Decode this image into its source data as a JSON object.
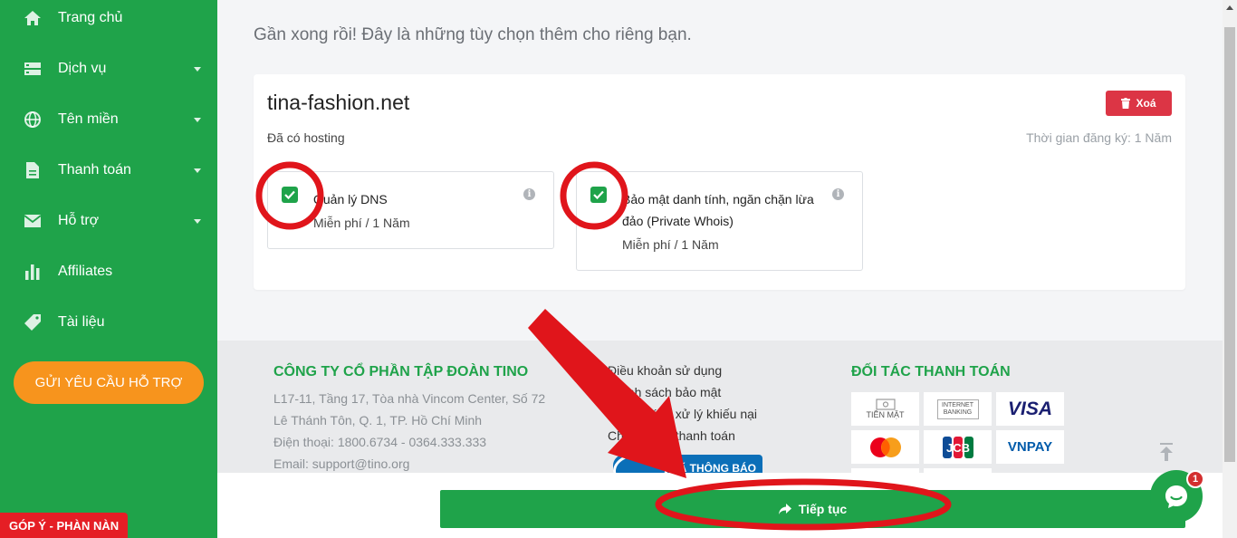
{
  "sidebar": {
    "items": [
      {
        "label": "Trang chủ",
        "icon": "home-icon",
        "has_submenu": false
      },
      {
        "label": "Dịch vụ",
        "icon": "server-icon",
        "has_submenu": true
      },
      {
        "label": "Tên miền",
        "icon": "globe-icon",
        "has_submenu": true
      },
      {
        "label": "Thanh toán",
        "icon": "document-icon",
        "has_submenu": true
      },
      {
        "label": "Hỗ trợ",
        "icon": "mail-icon",
        "has_submenu": true
      },
      {
        "label": "Affiliates",
        "icon": "bar-chart-icon",
        "has_submenu": false
      },
      {
        "label": "Tài liệu",
        "icon": "tag-icon",
        "has_submenu": false
      }
    ],
    "support_button": "GỬI YÊU CẦU HỖ TRỢ",
    "feedback_label": "GÓP Ý - PHÀN NÀN"
  },
  "main": {
    "headline": "Gần xong rồi! Đây là những tùy chọn thêm cho riêng bạn.",
    "domain": "tina-fashion.net",
    "hosting_status": "Đã có hosting",
    "registration_period": "Thời gian đăng ký: 1 Năm",
    "delete_label": "Xoá",
    "options": [
      {
        "title": "Quản lý DNS",
        "price": "Miễn phí / 1 Năm",
        "checked": true
      },
      {
        "title": "Bảo mật danh tính, ngăn chặn lừa đảo (Private Whois)",
        "price": "Miễn phí / 1 Năm",
        "checked": true
      }
    ]
  },
  "footer": {
    "company": "CÔNG TY CỔ PHẦN TẬP ĐOÀN TINO",
    "address_lines": [
      "L17-11, Tầng 17, Tòa nhà Vincom Center, Số 72",
      "Lê Thánh Tôn, Q. 1, TP. Hồ Chí Minh",
      "Điện thoại: 1800.6734 - 0364.333.333",
      "Email: support@tino.org"
    ],
    "links": [
      "Điều khoản sử dụng",
      "Chính sách bảo mật",
      "Chính sách xử lý khiếu nại",
      "Chính sách thanh toán"
    ],
    "certification": "ĐÃ THÔNG BÁO",
    "partners_title": "ĐỐI TÁC THANH TOÁN",
    "payment_methods": [
      "TIỀN MẶT",
      "INTERNET BANKING",
      "VISA",
      "mastercard",
      "JCB",
      "VNPAY"
    ]
  },
  "actions": {
    "continue_label": "Tiếp tục"
  },
  "chat": {
    "badge_count": "1"
  },
  "colors": {
    "brand_green": "#1fa34a",
    "danger_red": "#dc3545",
    "support_orange": "#f7941d",
    "annotation_red": "#e0151b"
  }
}
